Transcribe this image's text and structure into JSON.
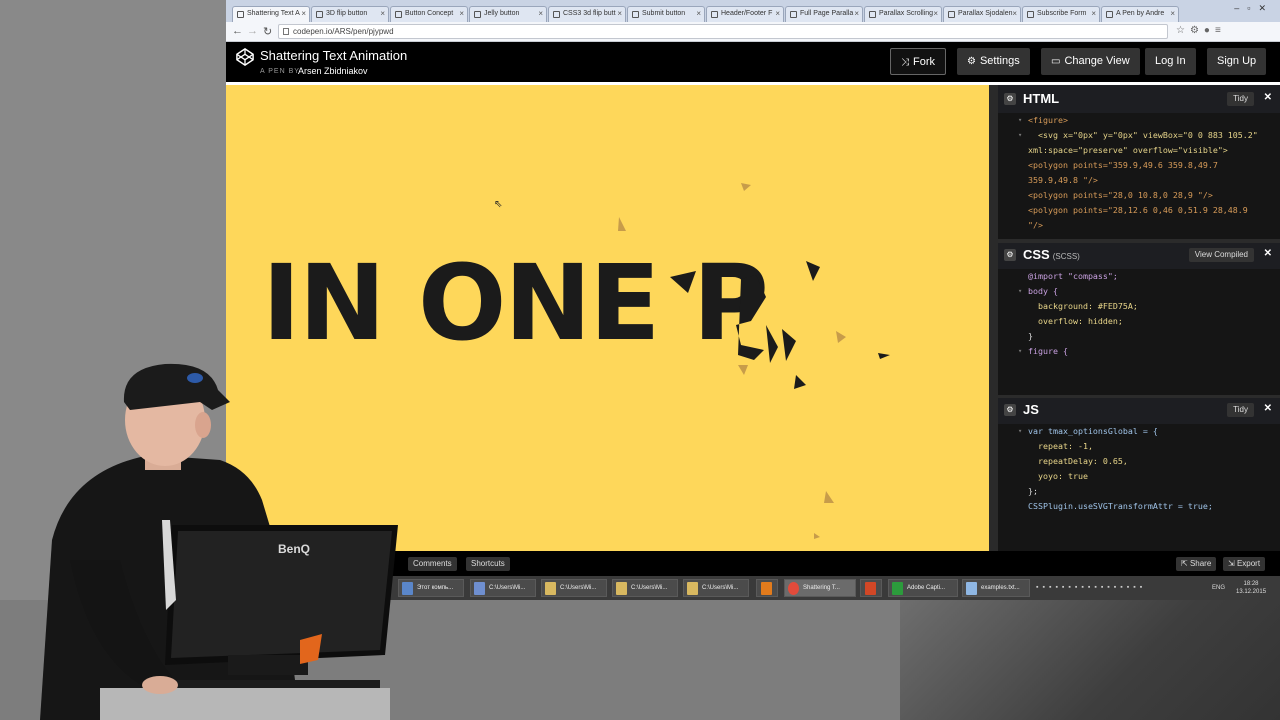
{
  "browser": {
    "tabs": [
      {
        "label": "Shattering Text A"
      },
      {
        "label": "3D flip button"
      },
      {
        "label": "Button Concept"
      },
      {
        "label": "Jelly button"
      },
      {
        "label": "CSS3 3d flip butt"
      },
      {
        "label": "Submit button"
      },
      {
        "label": "Header/Footer F"
      },
      {
        "label": "Full Page Paralla"
      },
      {
        "label": "Parallax Scrolling"
      },
      {
        "label": "Parallax Sjodalen"
      },
      {
        "label": "Subscribe Form"
      },
      {
        "label": "A Pen by Andre"
      }
    ],
    "url": "codepen.io/ARS/pen/pjypwd"
  },
  "pen": {
    "title": "Shattering Text Animation",
    "by_label": "A PEN BY",
    "author": "Arsen Zbidniakov"
  },
  "header_buttons": {
    "fork": "Fork",
    "settings": "Settings",
    "change_view": "Change View",
    "login": "Log In",
    "signup": "Sign Up"
  },
  "preview": {
    "background": "#FED75A",
    "text": "IN ONE P"
  },
  "editors": {
    "html": {
      "name": "HTML",
      "tidy": "Tidy",
      "lines": [
        "<figure>",
        "  <svg x=\"0px\" y=\"0px\" viewBox=\"0 0 883 105.2\"",
        "xml:space=\"preserve\" overflow=\"visible\">",
        "<polygon points=\"359.9,49.6 359.8,49.7",
        "359.9,49.8 \"/>",
        "<polygon points=\"28,0 10.8,0 28,9 \"/>",
        "<polygon points=\"28,12.6 0,46 0,51.9 28,48.9",
        "\"/>"
      ]
    },
    "css": {
      "name": "CSS",
      "sub": "(SCSS)",
      "view_compiled": "View Compiled",
      "lines": [
        "@import \"compass\";",
        "",
        "body {",
        "  background: #FED75A;",
        "  overflow: hidden;",
        "}",
        "",
        "figure {"
      ]
    },
    "js": {
      "name": "JS",
      "tidy": "Tidy",
      "lines": [
        "var tmax_optionsGlobal = {",
        "  repeat: -1,",
        "  repeatDelay: 0.65,",
        "  yoyo: true",
        "};",
        "",
        "CSSPlugin.useSVGTransformAttr = true;"
      ]
    }
  },
  "footer": {
    "comments": "Comments",
    "shortcuts": "Shortcuts",
    "share": "Share",
    "export": "Export"
  },
  "taskbar": {
    "items": [
      {
        "label": "Этот компь..."
      },
      {
        "label": "C:\\Users\\Mi..."
      },
      {
        "label": "C:\\Users\\Mi..."
      },
      {
        "label": "C:\\Users\\Mi..."
      },
      {
        "label": "C:\\Users\\Mi..."
      },
      {
        "label": "Shattering T..."
      },
      {
        "label": "Adobe Capti..."
      },
      {
        "label": "examples.txt..."
      }
    ],
    "lang": "ENG",
    "time": "18:28",
    "date": "13.12.2015"
  },
  "monitor_brand": "BenQ"
}
